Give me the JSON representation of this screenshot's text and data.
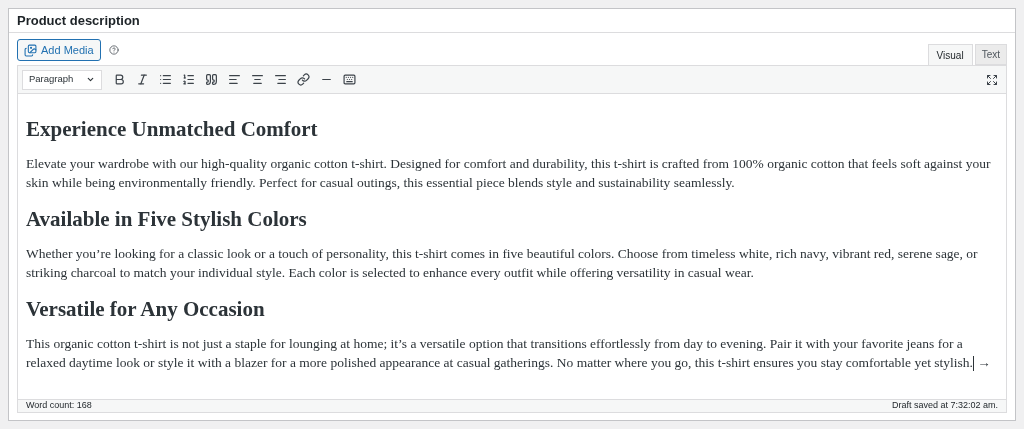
{
  "panel": {
    "title": "Product description"
  },
  "add_media": "Add Media",
  "tabs": [
    {
      "label": "Visual",
      "selected": true
    },
    {
      "label": "Text",
      "selected": false
    }
  ],
  "format_select": "Paragraph",
  "content": [
    {
      "kind": "heading",
      "text": "Experience Unmatched Comfort"
    },
    {
      "kind": "paragraph",
      "text": "Elevate your wardrobe with our high-quality organic cotton t-shirt. Designed for comfort and durability, this t-shirt is crafted from 100% organic cotton that feels soft against your skin while being environmentally friendly. Perfect for casual outings, this essential piece blends style and sustainability seamlessly."
    },
    {
      "kind": "heading",
      "text": "Available in Five Stylish Colors"
    },
    {
      "kind": "paragraph",
      "text": "Whether you’re looking for a classic look or a touch of personality, this t-shirt comes in five beautiful colors. Choose from timeless white, rich navy, vibrant red, serene sage, or striking charcoal to match your individual style. Each color is selected to enhance every outfit while offering versatility in casual wear."
    },
    {
      "kind": "heading",
      "text": "Versatile for Any Occasion"
    },
    {
      "kind": "paragraph",
      "text": "This organic cotton t-shirt is not just a staple for lounging at home; it’s a versatile option that transitions effortlessly from day to evening. Pair it with your favorite jeans for a relaxed daytime look or style it with a blazer for a more polished appearance at casual gatherings. No matter where you go, this t-shirt ensures you stay comfortable yet stylish.",
      "cursor": true,
      "trailing": "→"
    }
  ],
  "status_bar": {
    "word_count": "Word count: 168",
    "saved": "Draft saved at 7:32:02 am."
  }
}
